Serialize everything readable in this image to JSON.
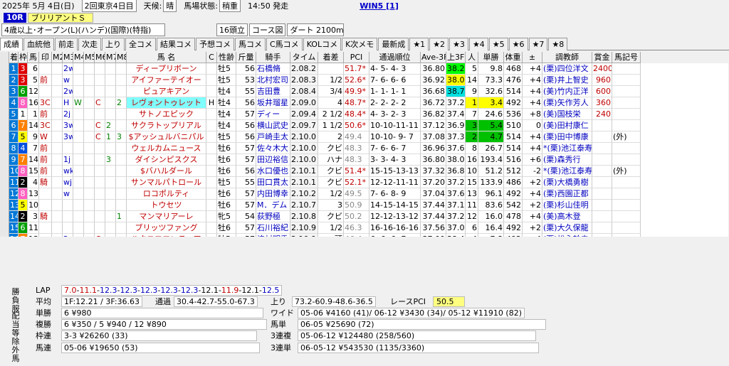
{
  "header": {
    "date": "2025年 5月 4日(日)",
    "meeting": "2回東京4日目",
    "weather_label": "天候:",
    "weather": "晴",
    "track_label": "馬場状態:",
    "track": "稍重",
    "time": "14:50 発走",
    "win5": "WIN5 [1]"
  },
  "race": {
    "no": "10R",
    "name": "ブリリアントＳ",
    "cond": "4歳以上･オープン(L)(ハンデ)(国際)(特指)",
    "heads": "16頭立",
    "course_label": "コース図",
    "course": "ダート 2100m"
  },
  "tabs": [
    "成績",
    "血統他",
    "前走",
    "次走",
    "上り",
    "全コメ",
    "結果コメ",
    "予想コメ",
    "馬コメ",
    "C馬コメ",
    "KOLコメ",
    "K次メモ",
    "最新成",
    "★1",
    "★2",
    "★3",
    "★4",
    "★5",
    "★6",
    "★7",
    "★8"
  ],
  "columns": [
    "着",
    "枠",
    "馬",
    "印",
    "M2",
    "M3",
    "M4",
    "M5",
    "M6",
    "M7",
    "M8",
    "馬 名",
    "C",
    "性齢",
    "斤量",
    "騎手",
    "タイム",
    "着差",
    "PCI",
    "通過順位",
    "Ave-3F",
    "上3F",
    "人",
    "単勝",
    "体重",
    "±",
    "調教師",
    "賞金",
    "馬記号"
  ],
  "rows": [
    [
      "1",
      "3",
      "6",
      "",
      "",
      "2w",
      "",
      "",
      "",
      "",
      "",
      "ディープリボーン",
      "",
      "牡5",
      "56",
      "石橋脩",
      "2.08.2",
      "",
      "51.7*",
      "4- 5- 4- 3",
      "36.80",
      "38.2",
      "5",
      "9.8",
      "468",
      "+4",
      "(栗)四位洋文",
      "2400",
      ""
    ],
    [
      "2",
      "3",
      "5",
      "前",
      "",
      "w",
      "",
      "",
      "",
      "",
      "",
      "アイファーテイオー",
      "",
      "牡5",
      "53",
      "北村宏司",
      "2.08.3",
      "1/2",
      "52.6*",
      "7- 6- 6- 6",
      "36.92",
      "38.0",
      "14",
      "73.3",
      "476",
      "+4",
      "(栗)井上智史",
      "960",
      ""
    ],
    [
      "3",
      "6",
      "12",
      "",
      "",
      "2w",
      "",
      "",
      "",
      "",
      "",
      "ピュアキアン",
      "",
      "牡4",
      "55",
      "吉田豊",
      "2.08.4",
      "3/4",
      "49.9*",
      "1- 1- 1- 1",
      "36.68",
      "38.7",
      "9",
      "32.6",
      "514",
      "+4",
      "(美)竹内正洋",
      "600",
      ""
    ],
    [
      "4",
      "8",
      "16",
      "3C",
      "",
      "H",
      "W",
      "",
      "C",
      "",
      "2",
      "レヴォントゥレット",
      "H",
      "牡4",
      "56",
      "坂井瑠星",
      "2.09.0",
      "4",
      "48.7*",
      "2- 2- 2- 2",
      "36.72",
      "37.2",
      "1",
      "3.4",
      "492",
      "+4",
      "(栗)矢作芳人",
      "360",
      ""
    ],
    [
      "5",
      "1",
      "1",
      "前",
      "",
      "2j",
      "",
      "",
      "",
      "",
      "",
      "サトノエピック",
      "",
      "牡4",
      "57",
      "ディー",
      "2.09.4",
      "2 1/2",
      "48.4*",
      "4- 3- 2- 3",
      "36.82",
      "37.4",
      "7",
      "24.6",
      "536",
      "+8",
      "(美)国枝栄",
      "240",
      ""
    ],
    [
      "6",
      "7",
      "14",
      "3C",
      "",
      "3w",
      "",
      "",
      "C",
      "2",
      "",
      "サクラトップリアル",
      "",
      "牡4",
      "56",
      "横山武史",
      "2.09.7",
      "1 1/2",
      "50.6*",
      "10-10-11-11",
      "37.12",
      "36.9",
      "3",
      "5.4",
      "510",
      "0",
      "(美)田村康仁",
      "",
      ""
    ],
    [
      "7",
      "5",
      "9",
      "W",
      "",
      "3w",
      "",
      "",
      "C",
      "1",
      "3",
      "$アッシュルバニパル",
      "",
      "牡5",
      "56",
      "戸崎圭太",
      "2.10.0",
      "2",
      "49.4",
      "10-10- 9- 7",
      "37.08",
      "37.3",
      "2",
      "4.7",
      "514",
      "+4",
      "(栗)田中博康",
      "",
      "(外)"
    ],
    [
      "8",
      "4",
      "7",
      "前",
      "",
      "",
      "",
      "",
      "",
      "",
      "",
      "ウェルカムニュース",
      "",
      "牡6",
      "57",
      "佐々木大",
      "2.10.0",
      "クビ",
      "48.3",
      "7- 6- 6- 7",
      "36.96",
      "37.6",
      "8",
      "26.7",
      "514",
      "+4",
      "*(栗)池江泰寿",
      "",
      ""
    ],
    [
      "9",
      "7",
      "14",
      "前",
      "",
      "1j",
      "",
      "",
      "",
      "3",
      "",
      "ダイシンピスクス",
      "",
      "牡6",
      "57",
      "田辺裕信",
      "2.10.0",
      "ハナ",
      "48.3",
      "3- 3- 4- 3",
      "36.80",
      "38.0",
      "16",
      "193.4",
      "516",
      "+6",
      "(栗)森秀行",
      "",
      ""
    ],
    [
      "10",
      "8",
      "15",
      "前",
      "",
      "wk",
      "",
      "",
      "",
      "",
      "",
      "$バハルダール",
      "",
      "牡6",
      "56",
      "水口優也",
      "2.10.1",
      "クビ",
      "51.4*",
      "15-15-13-13",
      "37.32",
      "36.8",
      "10",
      "51.2",
      "512",
      "-2",
      "*(栗)池江泰寿",
      "",
      "(外)"
    ],
    [
      "11",
      "2",
      "4",
      "騎",
      "",
      "wj",
      "",
      "",
      "",
      "",
      "",
      "サンマルパトロール",
      "",
      "牡5",
      "55",
      "田口貫太",
      "2.10.1",
      "クビ",
      "52.1*",
      "12-12-11-11",
      "37.20",
      "37.2",
      "15",
      "133.9",
      "486",
      "+2",
      "(栗)大橋勇樹",
      "",
      ""
    ],
    [
      "12",
      "8",
      "13",
      "",
      "",
      "w",
      "",
      "",
      "",
      "",
      "",
      "ロコポルティ",
      "",
      "牡6",
      "57",
      "内田博幸",
      "2.10.2",
      "1/2",
      "49.5",
      "7- 6- 8- 9",
      "37.04",
      "37.6",
      "13",
      "96.1",
      "492",
      "+4",
      "(栗)西園正都",
      "",
      ""
    ],
    [
      "13",
      "5",
      "10",
      "",
      "",
      "",
      "",
      "",
      "",
      "",
      "",
      "トウセツ",
      "",
      "牡6",
      "57",
      "M．デム",
      "2.10.7",
      "3",
      "50.9",
      "14-15-14-15",
      "37.44",
      "37.1",
      "11",
      "83.6",
      "542",
      "+2",
      "(栗)杉山佳明",
      "",
      ""
    ],
    [
      "14",
      "2",
      "3",
      "騎",
      "",
      "",
      "",
      "",
      "",
      "",
      "1",
      "マンマリアーレ",
      "",
      "牝5",
      "54",
      "荻野極",
      "2.10.8",
      "クビ",
      "50.2",
      "12-12-13-12",
      "37.44",
      "37.2",
      "12",
      "16.0",
      "478",
      "+4",
      "(美)高木登",
      "",
      ""
    ],
    [
      "15",
      "6",
      "11",
      "",
      "",
      "",
      "",
      "",
      "",
      "",
      "",
      "ブリッツファング",
      "",
      "牡6",
      "57",
      "石川裕紀",
      "2.10.9",
      "1/2",
      "46.3",
      "16-16-16-16",
      "37.56",
      "37.0",
      "6",
      "16.4",
      "492",
      "+2",
      "(栗)大久保龍",
      "",
      ""
    ],
    [
      "16",
      "7",
      "13",
      "",
      "",
      "2w",
      "",
      "",
      "C",
      "",
      "",
      "ルクスフロンティア",
      "",
      "牡5",
      "57",
      "津村明秀",
      "2.10.9",
      "頭",
      "46.4",
      "6- 6- 6- 7",
      "37.00",
      "38.4",
      "4",
      "7.8",
      "492",
      "+4",
      "(栗)松永幹夫",
      "",
      ""
    ]
  ],
  "bottom": {
    "tabs": [
      "勝負服",
      "配当等",
      "除外馬"
    ],
    "lap_label": "LAP",
    "lap": "7.0-11.1-12.3-12.3-12.3-12.3-12.3-12.1-11.9-12.1-12.5",
    "avg_label": "平均",
    "avg": "1F:12.21 / 3F:36.63",
    "pass_label": "通過",
    "pass": "30.4-42.7-55.0-67.3",
    "up_label": "上り",
    "up": "73.2-60.9-48.6-36.5",
    "pci_label": "レースPCI",
    "pci": "50.5",
    "tan_label": "単勝",
    "tan": "6 ¥980",
    "fuku_label": "複勝",
    "fuku": "6 ¥350 / 5 ¥940 / 12 ¥890",
    "waku_label": "枠連",
    "waku": "3-3 ¥26260 (33)",
    "uma_label": "馬連",
    "uma": "05-06 ¥19650 (53)",
    "wide_label": "ワイド",
    "wide": "05-06 ¥4160 (41)/ 06-12 ¥3430 (34)/ 05-12 ¥11910 (82)",
    "utan_label": "馬単",
    "utan": "06-05 ¥25690 (72)",
    "sanpuku_label": "3連複",
    "sanpuku": "05-06-12 ¥124480 (258/560)",
    "santan_label": "3連単",
    "santan": "06-05-12 ¥543530 (1135/3360)"
  },
  "colors": {
    "waku": {
      "1": "#ffffff",
      "2": "#000000",
      "3": "#e00000",
      "4": "#0050e0",
      "5": "#ffff00",
      "6": "#00a000",
      "7": "#ff8000",
      "8": "#ff60c0"
    },
    "rowno_bg": "#0078d7",
    "up3f_best": "#00e0e0",
    "up3f_2": "#ffff00",
    "up3f_3": "#00ff00"
  }
}
